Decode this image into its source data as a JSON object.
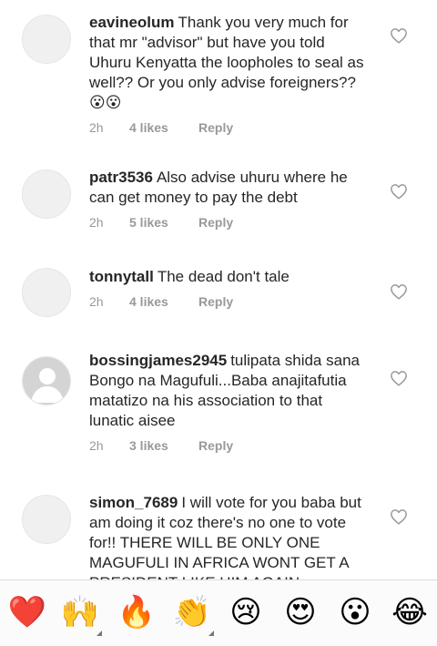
{
  "comments": [
    {
      "username": "eavineolum",
      "text": "Thank you very much for that mr \"advisor\" but have you told Uhuru Kenyatta the loopholes to seal as well?? Or you only advise foreigners??😮😮",
      "time": "2h",
      "likes": "4 likes",
      "reply": "Reply"
    },
    {
      "username": "patr3536",
      "text": "Also advise uhuru where he can get money to pay the debt",
      "time": "2h",
      "likes": "5 likes",
      "reply": "Reply"
    },
    {
      "username": "tonnytall",
      "text": "The dead don't tale",
      "time": "2h",
      "likes": "4 likes",
      "reply": "Reply"
    },
    {
      "username": "bossingjames2945",
      "text": "tulipata shida sana Bongo na Magufuli...Baba anajitafutia matatizo na his association to that lunatic aisee",
      "time": "2h",
      "likes": "3 likes",
      "reply": "Reply"
    },
    {
      "username": "simon_7689",
      "text": "I will vote for you baba but am doing it coz there's no one to vote for!! THERE WILL BE ONLY ONE MAGUFULI IN AFRICA WONT GET A PRESIDENT LIKE HIM AGAIN",
      "time": "",
      "likes": "",
      "reply": ""
    }
  ],
  "reactions": [
    {
      "emoji": "❤️",
      "icon": "red-heart-icon"
    },
    {
      "emoji": "🙌",
      "icon": "raising-hands-icon"
    },
    {
      "emoji": "🔥",
      "icon": "fire-icon"
    },
    {
      "emoji": "👏",
      "icon": "clapping-hands-icon"
    },
    {
      "emoji": "😢",
      "icon": "crying-face-icon"
    },
    {
      "emoji": "😍",
      "icon": "heart-eyes-icon"
    },
    {
      "emoji": "😮",
      "icon": "surprised-face-icon"
    },
    {
      "emoji": "😂",
      "icon": "tears-of-joy-icon"
    }
  ],
  "colors": {
    "text": "#262626",
    "meta": "#999999",
    "heart_outline": "#999999",
    "reaction_bar": "#fbfbfb"
  }
}
